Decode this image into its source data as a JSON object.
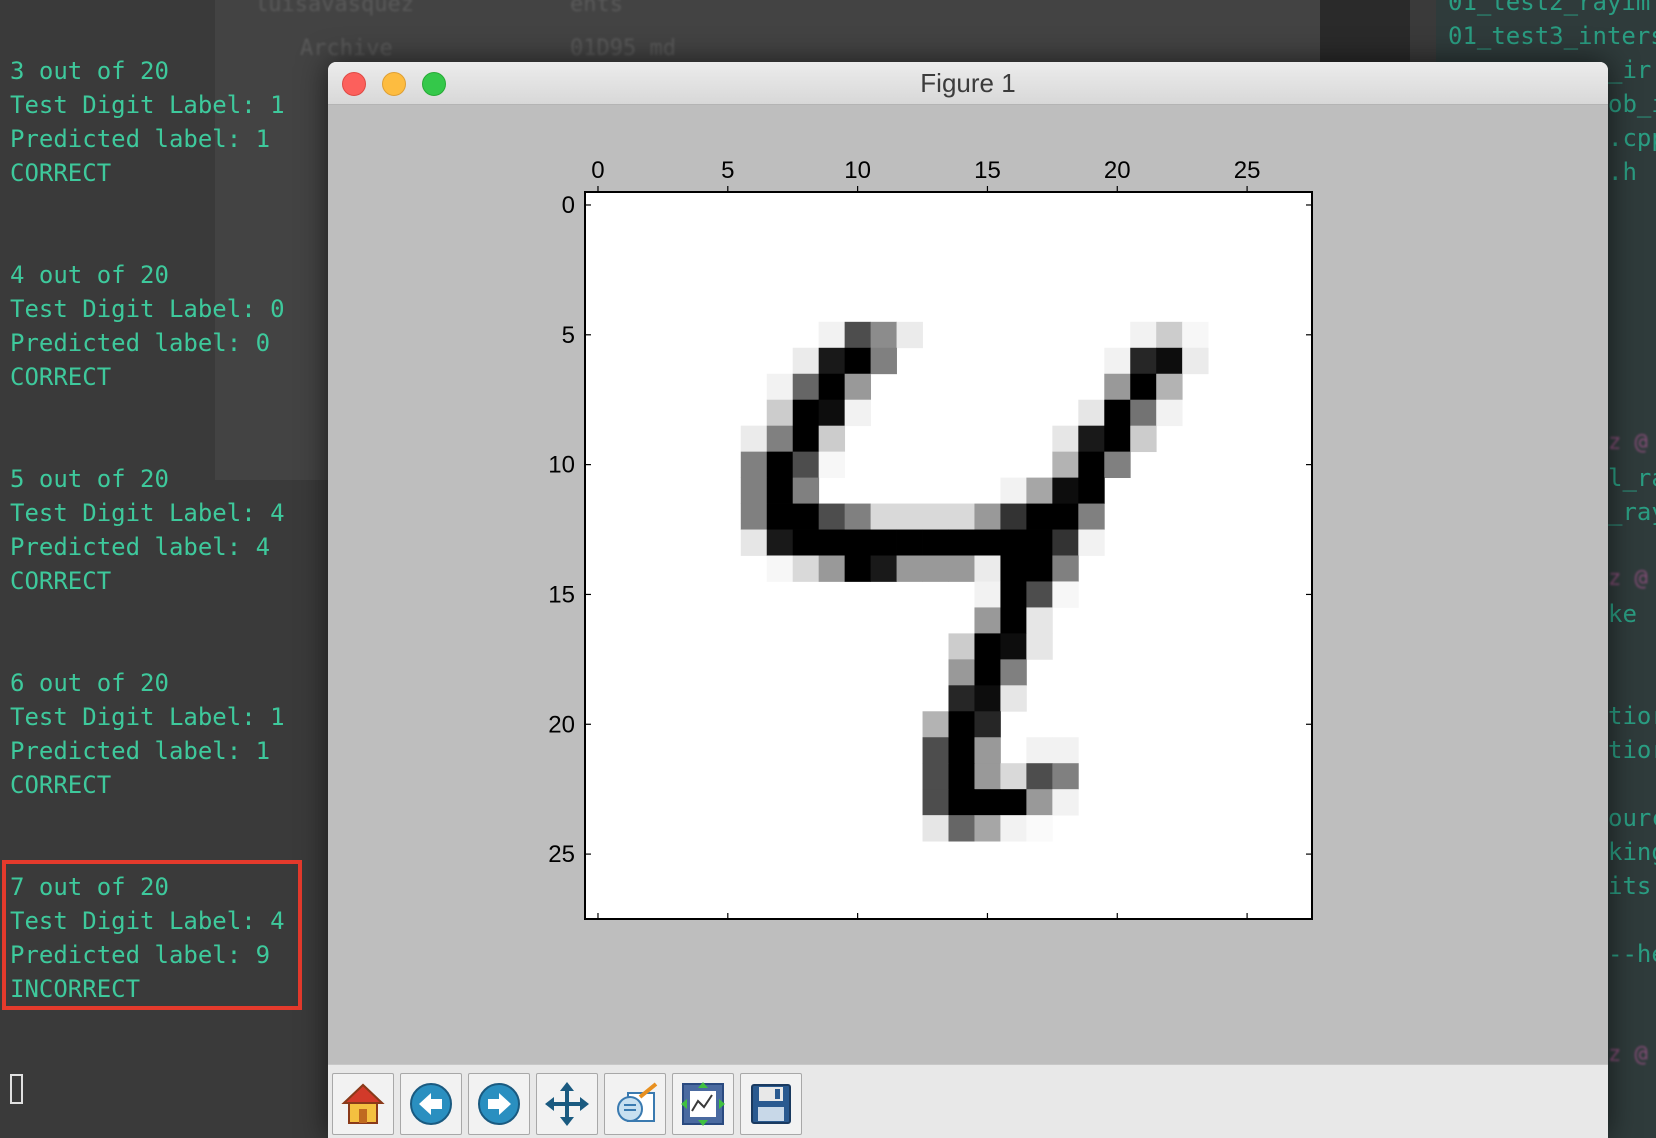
{
  "background": {
    "ghost_left": [
      "luisavasquez",
      "Archive",
      "",
      "",
      "",
      "",
      ""
    ],
    "ghost_mid": [
      "ents",
      "01D95 md"
    ],
    "ghost_right": [
      "01_test2_rayim",
      "01_test3_inters",
      "_ir",
      "ob_i",
      ".cpp",
      ".h",
      "",
      "",
      "",
      "",
      "",
      "",
      "",
      "tior",
      "tior",
      "ourc",
      "king",
      "its",
      "--he"
    ],
    "ghost_right_pink": [
      "z @",
      "z @",
      "z @"
    ],
    "ghost_right_teal": [
      "l_ra",
      "_ray",
      "ke"
    ]
  },
  "terminal": {
    "blocks": [
      {
        "count": "3 out of 20",
        "test": "Test Digit Label: 1",
        "pred": "Predicted label: 1",
        "result": "CORRECT"
      },
      {
        "count": "4 out of 20",
        "test": "Test Digit Label: 0",
        "pred": "Predicted label: 0",
        "result": "CORRECT"
      },
      {
        "count": "5 out of 20",
        "test": "Test Digit Label: 4",
        "pred": "Predicted label: 4",
        "result": "CORRECT"
      },
      {
        "count": "6 out of 20",
        "test": "Test Digit Label: 1",
        "pred": "Predicted label: 1",
        "result": "CORRECT"
      },
      {
        "count": "7 out of 20",
        "test": "Test Digit Label: 4",
        "pred": "Predicted label: 9",
        "result": "INCORRECT"
      }
    ],
    "text_color": "#3ec99c",
    "highlight_color": "#e43a2c"
  },
  "window": {
    "title": "Figure 1",
    "toolbar": [
      {
        "name": "home-button",
        "icon": "home-icon"
      },
      {
        "name": "back-button",
        "icon": "back-arrow-icon"
      },
      {
        "name": "forward-button",
        "icon": "forward-arrow-icon"
      },
      {
        "name": "pan-button",
        "icon": "move-icon"
      },
      {
        "name": "zoom-button",
        "icon": "zoom-rect-icon"
      },
      {
        "name": "configure-subplots-button",
        "icon": "subplots-icon"
      },
      {
        "name": "save-button",
        "icon": "floppy-disk-icon"
      }
    ]
  },
  "chart_data": {
    "type": "heatmap",
    "colormap": "gray_r",
    "title": "",
    "xlabel": "",
    "ylabel": "",
    "xlim": [
      -0.5,
      27.5
    ],
    "ylim": [
      27.5,
      -0.5
    ],
    "x_ticks": [
      0,
      5,
      10,
      15,
      20,
      25
    ],
    "y_ticks": [
      0,
      5,
      10,
      15,
      20,
      25
    ],
    "x_axis_position": "top",
    "grid": false,
    "pixels": [
      [
        0,
        0,
        0,
        0,
        0,
        0,
        0,
        0,
        0,
        0,
        0,
        0,
        0,
        0,
        0,
        0,
        0,
        0,
        0,
        0,
        0,
        0,
        0,
        0,
        0,
        0,
        0,
        0
      ],
      [
        0,
        0,
        0,
        0,
        0,
        0,
        0,
        0,
        0,
        0,
        0,
        0,
        0,
        0,
        0,
        0,
        0,
        0,
        0,
        0,
        0,
        0,
        0,
        0,
        0,
        0,
        0,
        0
      ],
      [
        0,
        0,
        0,
        0,
        0,
        0,
        0,
        0,
        0,
        0,
        0,
        0,
        0,
        0,
        0,
        0,
        0,
        0,
        0,
        0,
        0,
        0,
        0,
        0,
        0,
        0,
        0,
        0
      ],
      [
        0,
        0,
        0,
        0,
        0,
        0,
        0,
        0,
        0,
        0,
        0,
        0,
        0,
        0,
        0,
        0,
        0,
        0,
        0,
        0,
        0,
        0,
        0,
        0,
        0,
        0,
        0,
        0
      ],
      [
        0,
        0,
        0,
        0,
        0,
        0,
        0,
        0,
        0,
        0,
        0,
        0,
        0,
        0,
        0,
        0,
        0,
        0,
        0,
        0,
        0,
        0,
        0,
        0,
        0,
        0,
        0,
        0
      ],
      [
        0,
        0,
        0,
        0,
        0,
        0,
        0,
        0,
        0,
        0.05,
        0.7,
        0.45,
        0.08,
        0,
        0,
        0,
        0,
        0,
        0,
        0,
        0,
        0.05,
        0.2,
        0.03,
        0,
        0,
        0,
        0
      ],
      [
        0,
        0,
        0,
        0,
        0,
        0,
        0,
        0,
        0.08,
        0.9,
        1,
        0.5,
        0,
        0,
        0,
        0,
        0,
        0,
        0,
        0,
        0.05,
        0.85,
        0.95,
        0.08,
        0,
        0,
        0,
        0
      ],
      [
        0,
        0,
        0,
        0,
        0,
        0,
        0,
        0.05,
        0.6,
        1,
        0.4,
        0,
        0,
        0,
        0,
        0,
        0,
        0,
        0,
        0,
        0.4,
        1,
        0.3,
        0,
        0,
        0,
        0,
        0
      ],
      [
        0,
        0,
        0,
        0,
        0,
        0,
        0,
        0.2,
        1,
        0.95,
        0.05,
        0,
        0,
        0,
        0,
        0,
        0,
        0,
        0,
        0.1,
        1,
        0.55,
        0.05,
        0,
        0,
        0,
        0,
        0
      ],
      [
        0,
        0,
        0,
        0,
        0,
        0,
        0.08,
        0.5,
        1,
        0.2,
        0,
        0,
        0,
        0,
        0,
        0,
        0,
        0,
        0.1,
        0.9,
        1,
        0.2,
        0,
        0,
        0,
        0,
        0,
        0
      ],
      [
        0,
        0,
        0,
        0,
        0,
        0,
        0.5,
        1,
        0.7,
        0.03,
        0,
        0,
        0,
        0,
        0,
        0,
        0,
        0,
        0.3,
        1,
        0.5,
        0,
        0,
        0,
        0,
        0,
        0,
        0
      ],
      [
        0,
        0,
        0,
        0,
        0,
        0,
        0.5,
        1,
        0.5,
        0,
        0,
        0,
        0,
        0,
        0,
        0,
        0.05,
        0.35,
        0.95,
        1,
        0,
        0,
        0,
        0,
        0,
        0,
        0,
        0
      ],
      [
        0,
        0,
        0,
        0,
        0,
        0,
        0.5,
        1,
        1,
        0.7,
        0.5,
        0.15,
        0.15,
        0.15,
        0.15,
        0.4,
        0.8,
        1,
        1,
        0.5,
        0,
        0,
        0,
        0,
        0,
        0,
        0,
        0
      ],
      [
        0,
        0,
        0,
        0,
        0,
        0,
        0.1,
        0.9,
        1,
        1,
        1,
        1,
        1,
        1,
        1,
        1,
        1,
        1,
        0.8,
        0.05,
        0,
        0,
        0,
        0,
        0,
        0,
        0,
        0
      ],
      [
        0,
        0,
        0,
        0,
        0,
        0,
        0,
        0.03,
        0.15,
        0.4,
        1,
        0.9,
        0.4,
        0.4,
        0.4,
        0.08,
        1,
        1,
        0.5,
        0,
        0,
        0,
        0,
        0,
        0,
        0,
        0,
        0
      ],
      [
        0,
        0,
        0,
        0,
        0,
        0,
        0,
        0,
        0,
        0,
        0,
        0,
        0,
        0,
        0,
        0.05,
        1,
        0.7,
        0.03,
        0,
        0,
        0,
        0,
        0,
        0,
        0,
        0,
        0
      ],
      [
        0,
        0,
        0,
        0,
        0,
        0,
        0,
        0,
        0,
        0,
        0,
        0,
        0,
        0,
        0,
        0.4,
        1,
        0.1,
        0,
        0,
        0,
        0,
        0,
        0,
        0,
        0,
        0,
        0
      ],
      [
        0,
        0,
        0,
        0,
        0,
        0,
        0,
        0,
        0,
        0,
        0,
        0,
        0,
        0,
        0.2,
        1,
        0.95,
        0.1,
        0,
        0,
        0,
        0,
        0,
        0,
        0,
        0,
        0,
        0
      ],
      [
        0,
        0,
        0,
        0,
        0,
        0,
        0,
        0,
        0,
        0,
        0,
        0,
        0,
        0,
        0.4,
        1,
        0.5,
        0,
        0,
        0,
        0,
        0,
        0,
        0,
        0,
        0,
        0,
        0
      ],
      [
        0,
        0,
        0,
        0,
        0,
        0,
        0,
        0,
        0,
        0,
        0,
        0,
        0,
        0,
        0.85,
        0.95,
        0.1,
        0,
        0,
        0,
        0,
        0,
        0,
        0,
        0,
        0,
        0,
        0
      ],
      [
        0,
        0,
        0,
        0,
        0,
        0,
        0,
        0,
        0,
        0,
        0,
        0,
        0,
        0.3,
        1,
        0.85,
        0,
        0,
        0,
        0,
        0,
        0,
        0,
        0,
        0,
        0,
        0,
        0
      ],
      [
        0,
        0,
        0,
        0,
        0,
        0,
        0,
        0,
        0,
        0,
        0,
        0,
        0,
        0.7,
        1,
        0.4,
        0,
        0.05,
        0.05,
        0,
        0,
        0,
        0,
        0,
        0,
        0,
        0,
        0
      ],
      [
        0,
        0,
        0,
        0,
        0,
        0,
        0,
        0,
        0,
        0,
        0,
        0,
        0,
        0.7,
        1,
        0.4,
        0.15,
        0.7,
        0.5,
        0,
        0,
        0,
        0,
        0,
        0,
        0,
        0,
        0
      ],
      [
        0,
        0,
        0,
        0,
        0,
        0,
        0,
        0,
        0,
        0,
        0,
        0,
        0,
        0.7,
        1,
        1,
        1,
        0.4,
        0.05,
        0,
        0,
        0,
        0,
        0,
        0,
        0,
        0,
        0
      ],
      [
        0,
        0,
        0,
        0,
        0,
        0,
        0,
        0,
        0,
        0,
        0,
        0,
        0,
        0.1,
        0.6,
        0.35,
        0.05,
        0.02,
        0,
        0,
        0,
        0,
        0,
        0,
        0,
        0,
        0,
        0
      ],
      [
        0,
        0,
        0,
        0,
        0,
        0,
        0,
        0,
        0,
        0,
        0,
        0,
        0,
        0,
        0,
        0,
        0,
        0,
        0,
        0,
        0,
        0,
        0,
        0,
        0,
        0,
        0,
        0
      ],
      [
        0,
        0,
        0,
        0,
        0,
        0,
        0,
        0,
        0,
        0,
        0,
        0,
        0,
        0,
        0,
        0,
        0,
        0,
        0,
        0,
        0,
        0,
        0,
        0,
        0,
        0,
        0,
        0
      ],
      [
        0,
        0,
        0,
        0,
        0,
        0,
        0,
        0,
        0,
        0,
        0,
        0,
        0,
        0,
        0,
        0,
        0,
        0,
        0,
        0,
        0,
        0,
        0,
        0,
        0,
        0,
        0,
        0
      ]
    ]
  }
}
